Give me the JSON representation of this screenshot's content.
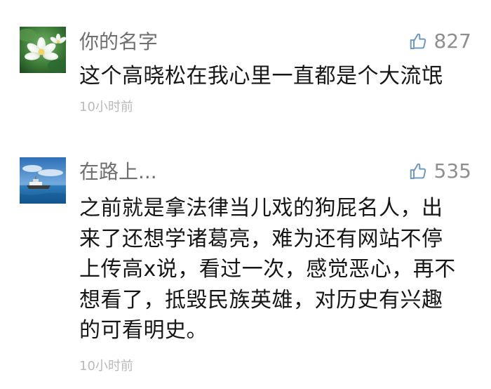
{
  "comments": [
    {
      "username": "你的名字",
      "like_icon": "thumbs-up-icon",
      "likes": "827",
      "text": "这个高晓松在我心里一直都是个大流氓",
      "time": "10小时前",
      "avatar": "lotus-flower-photo"
    },
    {
      "username": "在路上...",
      "like_icon": "thumbs-up-icon",
      "likes": "535",
      "text": "之前就是拿法律当儿戏的狗屁名人，出\n来了还想学诸葛亮，难为还有网站不停\n上传高x说，看过一次，感觉恶心，再不\n想看了，抵毁民族英雄，对历史有兴趣\n的可看明史。",
      "time": "10小时前",
      "avatar": "ship-at-sea-photo"
    }
  ],
  "colors": {
    "username": "#6f6f6f",
    "text": "#161616",
    "meta": "#b9b9b9",
    "likes": "#8e8e8e",
    "like_icon": "#6b96c4"
  }
}
